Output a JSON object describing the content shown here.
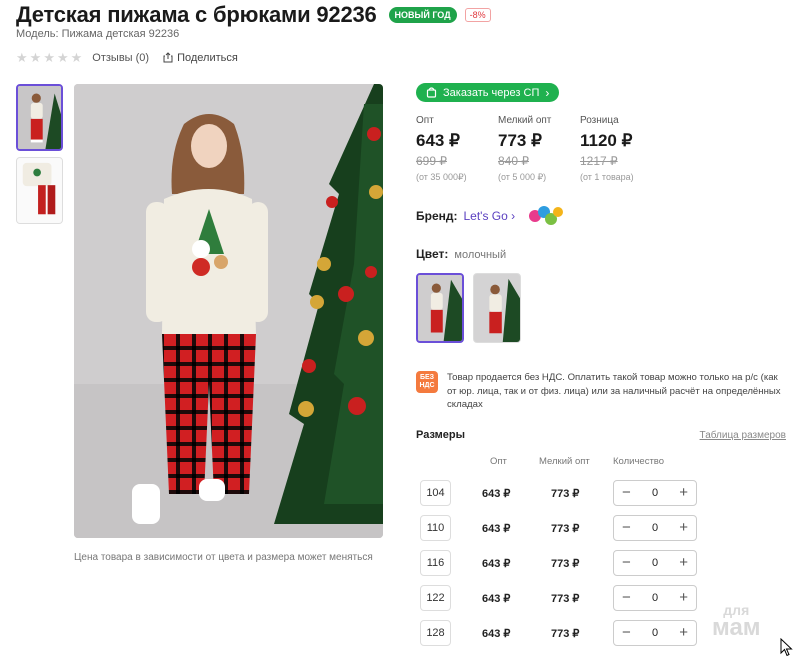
{
  "product": {
    "title": "Детская пижама с брюками 92236",
    "badge_new_year": "НОВЫЙ ГОД",
    "badge_discount": "-8%",
    "model": "Модель: Пижама детская 92236",
    "reviews": "Отзывы (0)",
    "share": "Поделиться",
    "rating_stars": 0
  },
  "gallery": {
    "note": "Цена товара в зависимости от цвета и размера может меняться",
    "thumbnails": [
      "photo-girl-pajama",
      "photo-pajama-flatlay"
    ],
    "active_thumbnail": 0
  },
  "order": {
    "sp_button": "Заказать через СП"
  },
  "prices": [
    {
      "label": "Опт",
      "value": "643 ₽",
      "old": "699 ₽",
      "min": "(от 35 000₽)"
    },
    {
      "label": "Мелкий опт",
      "value": "773 ₽",
      "old": "840 ₽",
      "min": "(от 5 000 ₽)"
    },
    {
      "label": "Розница",
      "value": "1120 ₽",
      "old": "1217 ₽",
      "min": "(от 1 товара)"
    }
  ],
  "brand": {
    "label": "Бренд:",
    "name": "Let's Go",
    "chevron": "›"
  },
  "color": {
    "label": "Цвет:",
    "value": "молочный",
    "swatches": [
      "girl-front-view",
      "girl-by-tree"
    ],
    "active": 0
  },
  "vat": {
    "icon_text": "БЕЗ НДС",
    "text": "Товар продается без НДС. Оплатить такой товар можно только на р/с (как от юр. лица, так и от физ. лица) или за наличный расчёт на определённых складах"
  },
  "sizes": {
    "title": "Размеры",
    "table_link": "Таблица размеров",
    "headers": {
      "opt": "Опт",
      "small_opt": "Мелкий опт",
      "qty": "Количество"
    },
    "rows": [
      {
        "size": "104",
        "opt": "643 ₽",
        "small_opt": "773 ₽",
        "qty": "0"
      },
      {
        "size": "110",
        "opt": "643 ₽",
        "small_opt": "773 ₽",
        "qty": "0"
      },
      {
        "size": "116",
        "opt": "643 ₽",
        "small_opt": "773 ₽",
        "qty": "0"
      },
      {
        "size": "122",
        "opt": "643 ₽",
        "small_opt": "773 ₽",
        "qty": "0"
      },
      {
        "size": "128",
        "opt": "643 ₽",
        "small_opt": "773 ₽",
        "qty": "0"
      }
    ]
  },
  "watermark": {
    "line1": "для",
    "line2": "мам"
  },
  "colors": {
    "accent": "#6b4fd8",
    "green": "#1fb14f",
    "discount": "#e0383e",
    "vat_badge": "#f47a3e"
  }
}
